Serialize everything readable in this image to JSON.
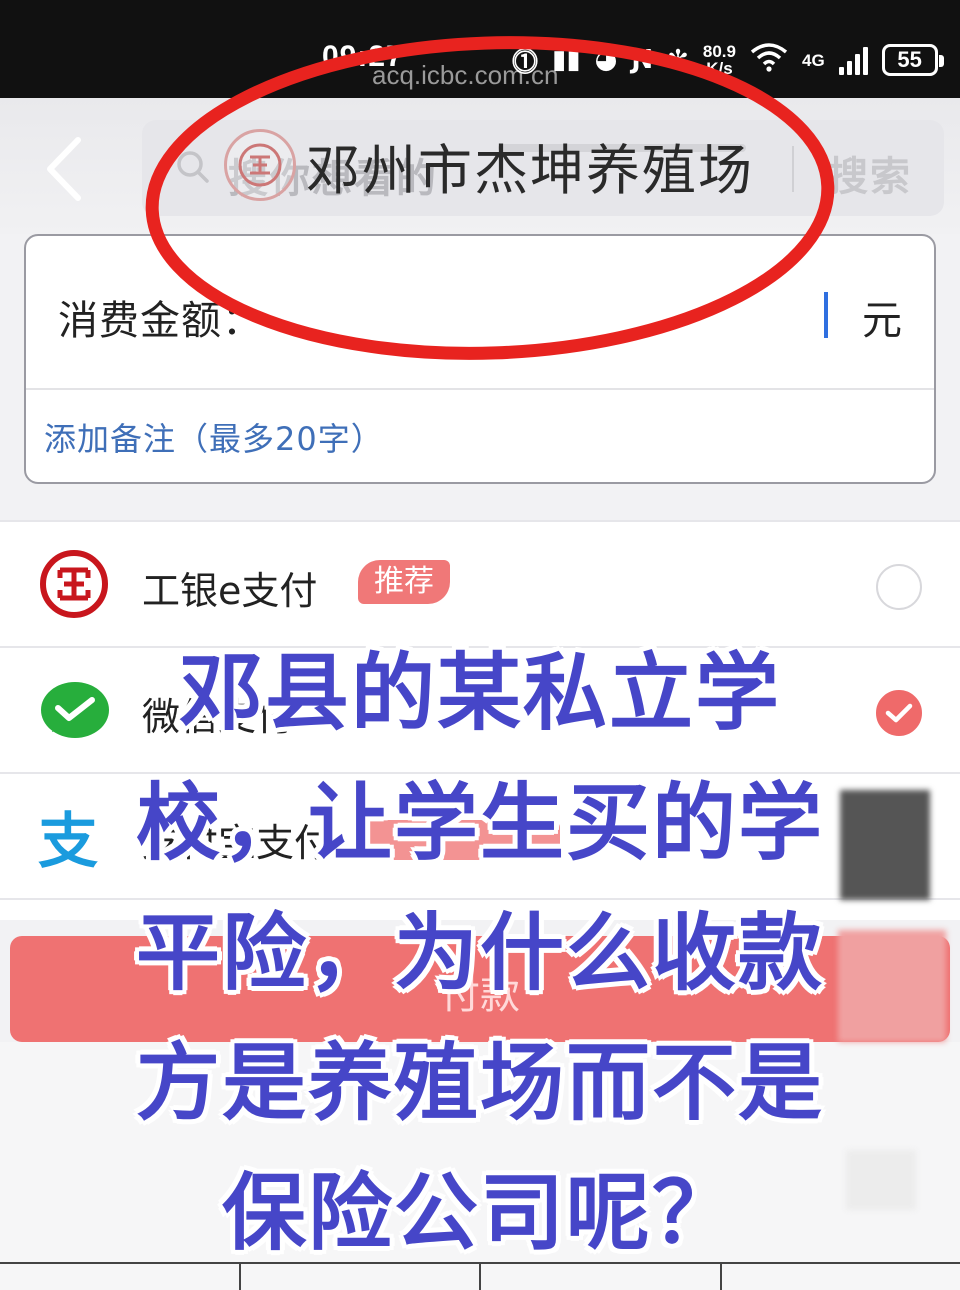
{
  "status_bar": {
    "time": "09:27",
    "url": "acq.icbc.com.cn",
    "network_speed": "80.9",
    "network_speed_unit": "K/s",
    "signal_label": "4G",
    "battery": "55"
  },
  "header": {
    "back_icon": "chevron-left-icon",
    "search_placeholder": "搜你想看的",
    "search_button": "搜索",
    "merchant_name": "邓州市杰坤养殖场"
  },
  "payment_form": {
    "amount_label": "消费金额：",
    "amount_value": "",
    "currency_unit": "元",
    "remark_placeholder": "添加备注（最多20字）"
  },
  "payment_methods": [
    {
      "label": "工银e支付",
      "badge": "推荐",
      "selected": false,
      "icon": "icbc-logo-icon"
    },
    {
      "label": "微信支付",
      "selected": true,
      "icon": "wechat-pay-icon"
    },
    {
      "label": "支付宝支付",
      "selected": false,
      "icon": "alipay-icon"
    }
  ],
  "pay_button": "付款",
  "overlay_caption": [
    "邓县的某私立学",
    "校，让学生买的学",
    "平险，为什么收款",
    "方是养殖场而不是",
    "保险公司呢？"
  ],
  "colors": {
    "caption": "#4646c8",
    "annotation_ellipse": "#e8231f",
    "pay_button": "#ef7272",
    "remark_text": "#3f6fb8"
  }
}
